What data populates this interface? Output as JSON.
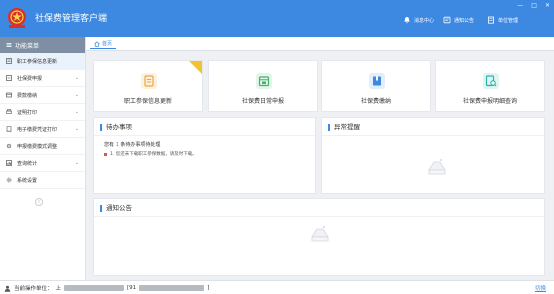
{
  "header": {
    "title": "社保费管理客户端",
    "messages_label": "消息中心",
    "notices_label": "通知公告",
    "units_label": "单位管理",
    "minimize": "—",
    "maximize": "□",
    "close": "✕"
  },
  "sidebar": {
    "heading": "功能菜单",
    "items": [
      {
        "label": "职工参保信息更新",
        "icon": "user-edit-icon",
        "has_arrow": false
      },
      {
        "label": "社保费申报",
        "icon": "declare-icon",
        "has_arrow": true
      },
      {
        "label": "费款缴纳",
        "icon": "pay-icon",
        "has_arrow": true
      },
      {
        "label": "证明打印",
        "icon": "print-icon",
        "has_arrow": true
      },
      {
        "label": "电子缴费凭证打印",
        "icon": "receipt-icon",
        "has_arrow": true
      },
      {
        "label": "申报缴费模式调整",
        "icon": "gear-icon",
        "has_arrow": false
      },
      {
        "label": "查询统计",
        "icon": "query-icon",
        "has_arrow": true
      },
      {
        "label": "系统设置",
        "icon": "settings-icon",
        "has_arrow": false
      }
    ],
    "collapse": "‹"
  },
  "tabs": [
    {
      "label": "首页",
      "icon": "home-icon"
    }
  ],
  "quick_actions": [
    {
      "label": "职工参保信息更新",
      "color": "#f3a43b",
      "bg": "#fdf2e2",
      "icon": "doc-edit-icon"
    },
    {
      "label": "社保费日常申报",
      "color": "#45b26b",
      "bg": "#e3f4e9",
      "icon": "calendar-icon"
    },
    {
      "label": "社保费缴纳",
      "color": "#3d88e0",
      "bg": "#e2eefb",
      "icon": "book-icon"
    },
    {
      "label": "社保费申报明细查询",
      "color": "#2fb3a8",
      "bg": "#def5f3",
      "icon": "search-doc-icon"
    }
  ],
  "todo": {
    "title": "待办事项",
    "summary_prefix": "您有",
    "summary_count": "1",
    "summary_suffix": "条待办事项待处理",
    "items": [
      "1. 您还未下载职工参保数据，请及时下载。"
    ]
  },
  "alerts": {
    "title": "异常提醒"
  },
  "notices": {
    "title": "通知公告"
  },
  "status": {
    "operator_label": "当前操作单位：",
    "operator_prefix": "上",
    "operator_mid": "[91",
    "operator_end": "]",
    "switch_label": "切换"
  },
  "colors": {
    "brand": "#3d88e0",
    "header_bg": "#3d88e0",
    "sidebar_head": "#7f8fa3",
    "alert_dot": "#d9534f",
    "corner_badge": "#f1c232"
  }
}
